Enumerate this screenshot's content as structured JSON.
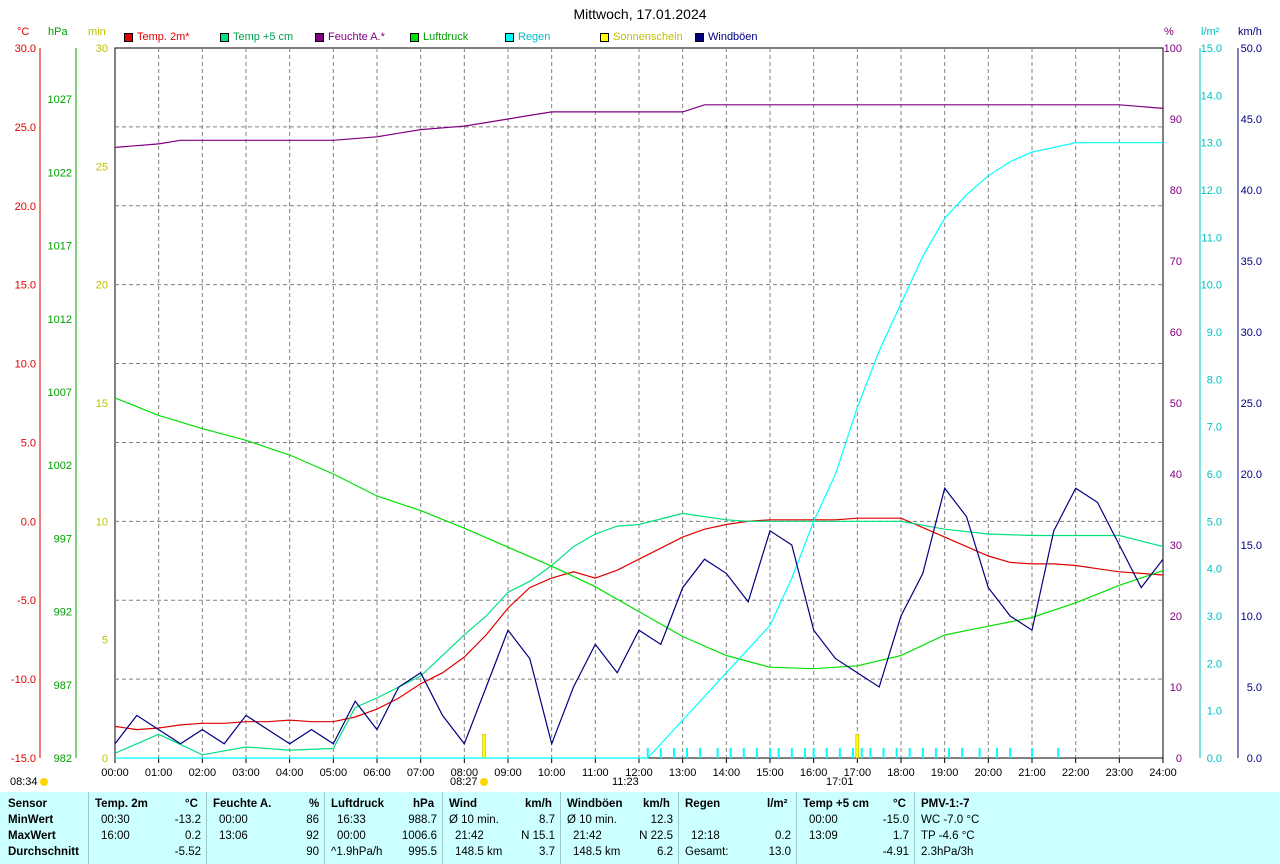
{
  "title": "Mittwoch, 17.01.2024",
  "units": {
    "temp": "°C",
    "pressure": "hPa",
    "sun": "min",
    "humidity": "%",
    "rain": "l/m²",
    "wind": "km/h"
  },
  "colors": {
    "temp2m": "#e00000",
    "temp5cm": "#00e080",
    "humidity": "#800080",
    "pressure": "#00e000",
    "rain": "#00ffff",
    "sun": "#ffff00",
    "gusts": "#000080",
    "grid": "#808080",
    "stats_bg": "#ccffff"
  },
  "legend": [
    {
      "label": "Temp. 2m*",
      "color": "#e00000",
      "text_color": "#e00000"
    },
    {
      "label": "Temp +5 cm",
      "color": "#00e080",
      "text_color": "#00a050"
    },
    {
      "label": "Feuchte A.*",
      "color": "#800080",
      "text_color": "#800080"
    },
    {
      "label": "Luftdruck",
      "color": "#00e000",
      "text_color": "#00a000"
    },
    {
      "label": "Regen",
      "color": "#00ffff",
      "text_color": "#00c0c0"
    },
    {
      "label": "Sonnenschein",
      "color": "#ffff00",
      "text_color": "#c0c000"
    },
    {
      "label": "Windböen",
      "color": "#000080",
      "text_color": "#000080"
    }
  ],
  "chart_data": {
    "type": "line",
    "title": "Mittwoch, 17.01.2024",
    "grid": true,
    "x_ticks": [
      "00:00",
      "01:00",
      "02:00",
      "03:00",
      "04:00",
      "05:00",
      "06:00",
      "07:00",
      "08:00",
      "09:00",
      "10:00",
      "11:00",
      "12:00",
      "13:00",
      "14:00",
      "15:00",
      "16:00",
      "17:00",
      "18:00",
      "19:00",
      "20:00",
      "21:00",
      "22:00",
      "23:00",
      "24:00"
    ],
    "axes": {
      "temp": {
        "unit": "°C",
        "range": [
          -15,
          30
        ],
        "ticks": [
          "30.0",
          "25.0",
          "20.0",
          "15.0",
          "10.0",
          "5.0",
          "0.0",
          "-5.0",
          "-10.0",
          "-15.0"
        ]
      },
      "pressure": {
        "unit": "hPa",
        "range": [
          982,
          1030.5
        ],
        "ticks": [
          "1027",
          "1022",
          "1017",
          "1012",
          "1007",
          "1002",
          "997",
          "992",
          "987",
          "982"
        ]
      },
      "sun": {
        "unit": "min",
        "range": [
          0,
          30
        ],
        "ticks": [
          "30",
          "25",
          "20",
          "15",
          "10",
          "5",
          "0"
        ]
      },
      "humidity": {
        "unit": "%",
        "range": [
          0,
          100
        ],
        "ticks": [
          "100",
          "90",
          "80",
          "70",
          "60",
          "50",
          "40",
          "30",
          "20",
          "10",
          "0"
        ]
      },
      "rain": {
        "unit": "l/m²",
        "range": [
          0,
          15
        ],
        "ticks": [
          "15.0",
          "14.0",
          "13.0",
          "12.0",
          "11.0",
          "10.0",
          "9.0",
          "8.0",
          "7.0",
          "6.0",
          "5.0",
          "4.0",
          "3.0",
          "2.0",
          "1.0",
          "0.0"
        ]
      },
      "wind": {
        "unit": "km/h",
        "range": [
          0,
          50
        ],
        "ticks": [
          "50.0",
          "45.0",
          "40.0",
          "35.0",
          "30.0",
          "25.0",
          "20.0",
          "15.0",
          "10.0",
          "5.0",
          "0.0"
        ]
      }
    },
    "series": [
      {
        "name": "Temp. 2m*",
        "axis": "temp",
        "color": "#e00000",
        "x": [
          0,
          0.5,
          1,
          1.5,
          2,
          2.5,
          3,
          3.5,
          4,
          4.5,
          5,
          5.5,
          6,
          6.5,
          7,
          7.5,
          8,
          8.5,
          9,
          9.5,
          10,
          10.5,
          11,
          11.5,
          12,
          12.5,
          13,
          13.5,
          14,
          14.5,
          15,
          15.5,
          16,
          16.5,
          17,
          17.5,
          18,
          18.5,
          19,
          19.5,
          20,
          20.5,
          21,
          21.5,
          22,
          22.5,
          23,
          23.5,
          24
        ],
        "y": [
          -13.0,
          -13.2,
          -13.1,
          -12.9,
          -12.8,
          -12.8,
          -12.7,
          -12.7,
          -12.6,
          -12.7,
          -12.7,
          -12.4,
          -11.9,
          -11.2,
          -10.3,
          -9.6,
          -8.6,
          -7.2,
          -5.5,
          -4.2,
          -3.6,
          -3.2,
          -3.6,
          -3.1,
          -2.4,
          -1.7,
          -1.0,
          -0.5,
          -0.2,
          0.0,
          0.1,
          0.1,
          0.1,
          0.1,
          0.2,
          0.2,
          0.2,
          -0.4,
          -1.0,
          -1.6,
          -2.2,
          -2.6,
          -2.7,
          -2.7,
          -2.8,
          -3.0,
          -3.2,
          -3.3,
          -3.4
        ]
      },
      {
        "name": "Temp +5 cm",
        "axis": "temp",
        "color": "#00e080",
        "x": [
          0,
          1,
          2,
          3,
          4,
          5,
          5.5,
          6,
          6.5,
          7,
          7.5,
          8,
          8.5,
          9,
          9.5,
          10,
          10.5,
          11,
          11.5,
          12,
          13,
          13.5,
          14,
          14.5,
          15,
          15.5,
          16,
          17,
          18,
          19,
          20,
          21,
          22,
          23,
          24
        ],
        "y": [
          -14.7,
          -13.5,
          -14.8,
          -14.3,
          -14.5,
          -14.4,
          -11.8,
          -11.2,
          -10.5,
          -9.8,
          -8.5,
          -7.2,
          -6.0,
          -4.5,
          -3.8,
          -2.8,
          -1.6,
          -0.8,
          -0.3,
          -0.2,
          0.5,
          0.3,
          0.1,
          0.0,
          0.0,
          0.0,
          0.0,
          0.0,
          0.0,
          -0.5,
          -0.8,
          -0.9,
          -0.9,
          -0.9,
          -1.6
        ]
      },
      {
        "name": "Feuchte A.*",
        "axis": "humidity",
        "color": "#800080",
        "x": [
          0,
          1,
          1.5,
          2,
          3,
          4,
          5,
          6,
          6.5,
          7,
          8,
          9,
          9.5,
          10,
          11,
          12,
          13,
          13.5,
          14,
          16,
          18,
          20,
          22,
          23,
          24
        ],
        "y": [
          86,
          86.5,
          87,
          87,
          87,
          87,
          87,
          87.5,
          88,
          88.5,
          89,
          90,
          90.5,
          91,
          91,
          91,
          91,
          92,
          92,
          92,
          92,
          92,
          92,
          92,
          91.5
        ]
      },
      {
        "name": "Luftdruck",
        "axis": "pressure",
        "color": "#00e000",
        "x": [
          0,
          1,
          2,
          3,
          4,
          5,
          6,
          7,
          8,
          9,
          10,
          11,
          12,
          13,
          14,
          15,
          16,
          17,
          18,
          19,
          20,
          21,
          22,
          23,
          24
        ],
        "y": [
          1006.6,
          1005.4,
          1004.5,
          1003.7,
          1002.7,
          1001.4,
          999.9,
          998.9,
          997.7,
          996.4,
          995.1,
          993.7,
          992.0,
          990.3,
          989.0,
          988.2,
          988.1,
          988.3,
          989.0,
          990.4,
          991.0,
          991.6,
          992.6,
          993.8,
          994.8
        ]
      },
      {
        "name": "Regen",
        "axis": "rain",
        "color": "#00ffff",
        "x": [
          0,
          12.2,
          13,
          14,
          15,
          15.5,
          16,
          16.5,
          17,
          17.5,
          18,
          18.5,
          19,
          19.5,
          20,
          20.5,
          21,
          21.5,
          22,
          23,
          24
        ],
        "y": [
          0,
          0,
          0.8,
          1.8,
          2.8,
          3.8,
          5.0,
          6.0,
          7.4,
          8.6,
          9.6,
          10.6,
          11.4,
          11.9,
          12.3,
          12.6,
          12.8,
          12.9,
          13.0,
          13.0,
          13.0
        ]
      },
      {
        "name": "Windböen",
        "axis": "wind",
        "color": "#000080",
        "x": [
          0,
          0.5,
          1,
          1.5,
          2,
          2.5,
          3,
          3.5,
          4,
          4.5,
          5,
          5.5,
          6,
          6.5,
          7,
          7.5,
          8,
          8.5,
          9,
          9.5,
          10,
          10.5,
          11,
          11.5,
          12,
          12.5,
          13,
          13.5,
          14,
          14.5,
          15,
          15.5,
          16,
          16.5,
          17,
          17.5,
          18,
          18.5,
          19,
          19.5,
          20,
          20.5,
          21,
          21.5,
          22,
          22.5,
          23,
          23.5,
          24
        ],
        "y": [
          1,
          3,
          2,
          1,
          2,
          1,
          3,
          2,
          1,
          2,
          1,
          4,
          2,
          5,
          6,
          3,
          1,
          5,
          9,
          7,
          1,
          5,
          8,
          6,
          9,
          8,
          12,
          14,
          13,
          11,
          16,
          15,
          9,
          7,
          6,
          5,
          10,
          13,
          19,
          17,
          12,
          10,
          9,
          16,
          19,
          18,
          15,
          12,
          14
        ]
      }
    ],
    "sun_bars": {
      "axis": "sun",
      "color": "#ffff00",
      "x": [
        8.45,
        17.0
      ],
      "y": [
        1,
        1
      ]
    },
    "rain_ticks_hours": [
      12.2,
      12.5,
      12.8,
      13.1,
      13.4,
      13.8,
      14.1,
      14.4,
      14.7,
      15.0,
      15.2,
      15.5,
      15.8,
      16.0,
      16.3,
      16.6,
      16.9,
      17.1,
      17.3,
      17.6,
      17.9,
      18.2,
      18.5,
      18.8,
      19.1,
      19.4,
      19.8,
      20.2,
      20.5,
      21.0,
      21.6
    ]
  },
  "sun_notes": {
    "sunrise": "08:34",
    "sunrise_chart": "08:27",
    "noon": "11:23",
    "sunset": "17:01"
  },
  "stats": {
    "sensor": {
      "header": "Sensor",
      "rows": [
        "MinWert",
        "MaxWert",
        "Durchschnitt"
      ]
    },
    "temp2m": {
      "header": "Temp. 2m",
      "unit": "°C",
      "rows": [
        [
          "00:30",
          "-13.2"
        ],
        [
          "16:00",
          "0.2"
        ],
        [
          "",
          "-5.52"
        ]
      ]
    },
    "humidity": {
      "header": "Feuchte A.",
      "unit": "%",
      "rows": [
        [
          "00:00",
          "86"
        ],
        [
          "13:06",
          "92"
        ],
        [
          "",
          "90"
        ]
      ]
    },
    "pressure": {
      "header": "Luftdruck",
      "unit": "hPa",
      "rows": [
        [
          "16:33",
          "988.7"
        ],
        [
          "00:00",
          "1006.6"
        ],
        [
          "^1.9hPa/h",
          "995.5"
        ]
      ]
    },
    "wind": {
      "header": "Wind",
      "unit": "km/h",
      "rows": [
        [
          "Ø 10 min.",
          "8.7"
        ],
        [
          "21:42",
          "N 15.1"
        ],
        [
          "148.5 km",
          "3.7"
        ]
      ]
    },
    "gusts": {
      "header": "Windböen",
      "unit": "km/h",
      "rows": [
        [
          "Ø 10 min.",
          "12.3"
        ],
        [
          "21:42",
          "N 22.5"
        ],
        [
          "148.5 km",
          "6.2"
        ]
      ]
    },
    "rain": {
      "header": "Regen",
      "unit": "l/m²",
      "rows": [
        [
          "",
          ""
        ],
        [
          "12:18",
          "0.2"
        ],
        [
          "Gesamt:",
          "13.0"
        ]
      ]
    },
    "temp5cm": {
      "header": "Temp +5 cm",
      "unit": "°C",
      "rows": [
        [
          "00:00",
          "-15.0"
        ],
        [
          "13:09",
          "1.7"
        ],
        [
          "",
          "-4.91"
        ]
      ]
    },
    "pmv": {
      "header": "PMV-1:-7",
      "rows": [
        "WC -7.0 °C",
        "TP -4.6 °C",
        "2.3hPa/3h"
      ]
    }
  }
}
